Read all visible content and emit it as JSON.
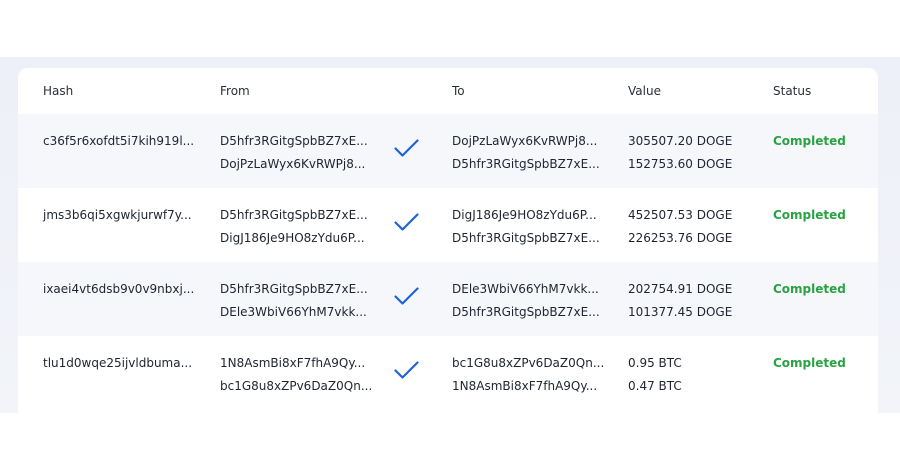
{
  "table": {
    "headers": {
      "hash": "Hash",
      "from": "From",
      "to": "To",
      "value": "Value",
      "status": "Status"
    },
    "rows": [
      {
        "hash": "c36f5r6xofdt5i7kih919l...",
        "from": [
          "D5hfr3RGitgSpbBZ7xE...",
          "DojPzLaWyx6KvRWPj8..."
        ],
        "to": [
          "DojPzLaWyx6KvRWPj8...",
          "D5hfr3RGitgSpbBZ7xE..."
        ],
        "value": [
          "305507.20 DOGE",
          "152753.60 DOGE"
        ],
        "status": "Completed"
      },
      {
        "hash": "jms3b6qi5xgwkjurwf7y...",
        "from": [
          "D5hfr3RGitgSpbBZ7xE...",
          "DigJ186Je9HO8zYdu6P..."
        ],
        "to": [
          "DigJ186Je9HO8zYdu6P...",
          "D5hfr3RGitgSpbBZ7xE..."
        ],
        "value": [
          "452507.53 DOGE",
          "226253.76 DOGE"
        ],
        "status": "Completed"
      },
      {
        "hash": "ixaei4vt6dsb9v0v9nbxj...",
        "from": [
          "D5hfr3RGitgSpbBZ7xE...",
          "DEle3WbiV66YhM7vkk..."
        ],
        "to": [
          "DEle3WbiV66YhM7vkk...",
          "D5hfr3RGitgSpbBZ7xE..."
        ],
        "value": [
          "202754.91 DOGE",
          "101377.45 DOGE"
        ],
        "status": "Completed"
      },
      {
        "hash": "tlu1d0wqe25ijvldbuma...",
        "from": [
          "1N8AsmBi8xF7fhA9Qy...",
          "bc1G8u8xZPv6DaZ0Qn..."
        ],
        "to": [
          "bc1G8u8xZPv6DaZ0Qn...",
          "1N8AsmBi8xF7fhA9Qy..."
        ],
        "value": [
          "0.95 BTC",
          "0.47 BTC"
        ],
        "status": "Completed"
      }
    ]
  },
  "icons": {
    "transfer": "checkmark-icon"
  },
  "colors": {
    "status_completed": "#29a342",
    "checkmark": "#1f63d9",
    "row_alt": "#f6f7fb",
    "background_band": "#edf0f8"
  }
}
